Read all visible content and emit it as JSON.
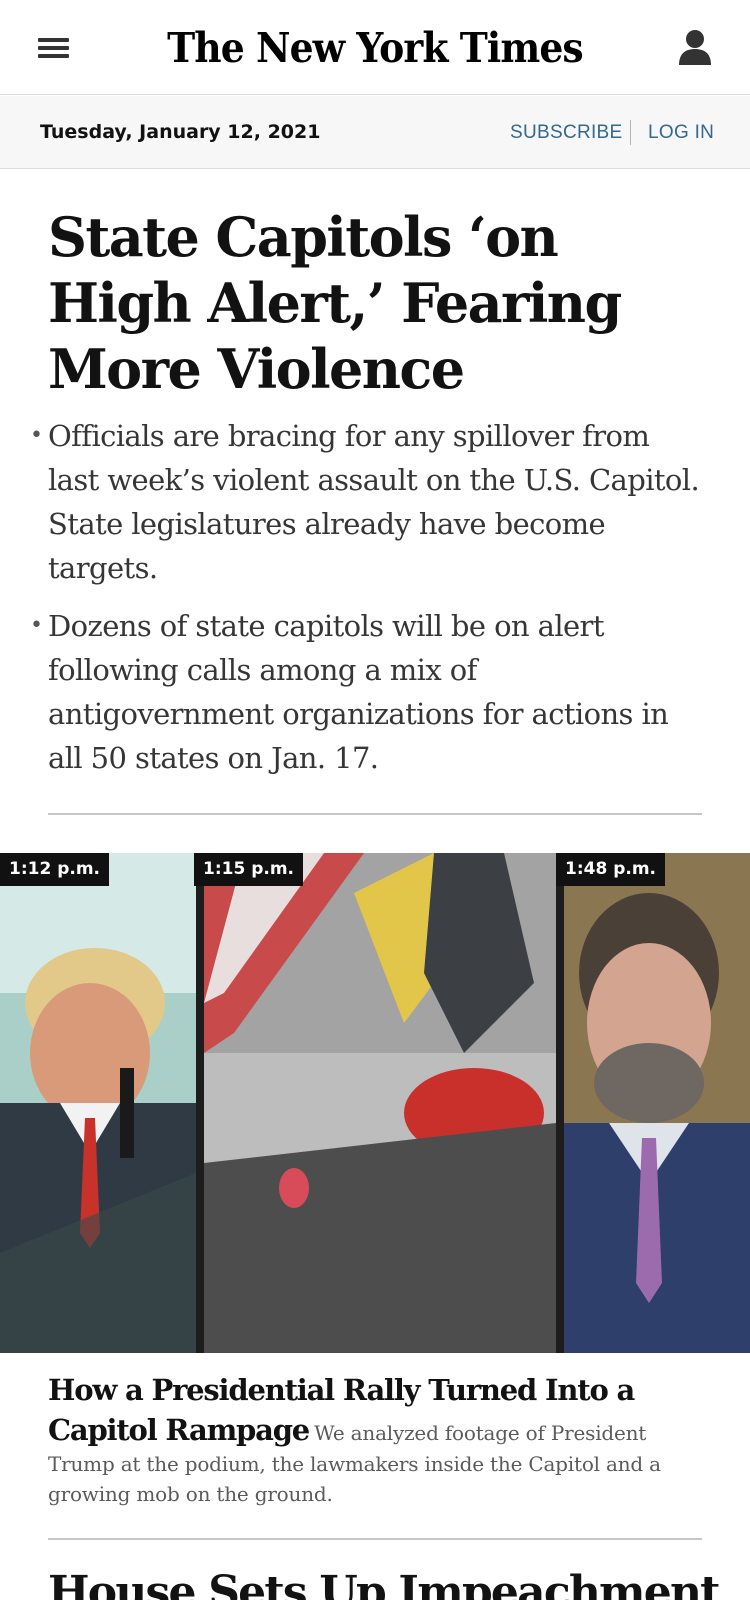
{
  "header": {
    "masthead": "The New York Times",
    "menu_icon": "hamburger-menu-icon",
    "account_icon": "user-account-icon"
  },
  "datebar": {
    "date": "Tuesday, January 12, 2021",
    "subscribe": "SUBSCRIBE",
    "login": "LOG IN"
  },
  "lead_story": {
    "headline": "State Capitols ‘on High Alert,’ Fearing More Violence",
    "summary": [
      "Officials are bracing for any spillover from last week’s violent assault on the U.S. Capitol. State legislatures already have become targets.",
      "Dozens of state capitols will be on alert following calls among a mix of antigovernment organizations for actions in all 50 states on Jan. 17."
    ]
  },
  "video": {
    "timestamps": [
      "1:12 p.m.",
      "1:15 p.m.",
      "1:48 p.m."
    ],
    "caption_title": "How a Presidential Rally Turned Into a Capitol Rampage",
    "caption_body": "We analyzed footage of President Trump at the podium, the lawmakers inside the Capitol and a growing mob on the ground."
  },
  "next_story": {
    "headline": "House Sets Up Impeachment Vote to"
  },
  "colors": {
    "link_blue": "#326891",
    "datebar_bg": "#f7f7f7",
    "text": "#121212",
    "summary_text": "#363636"
  }
}
